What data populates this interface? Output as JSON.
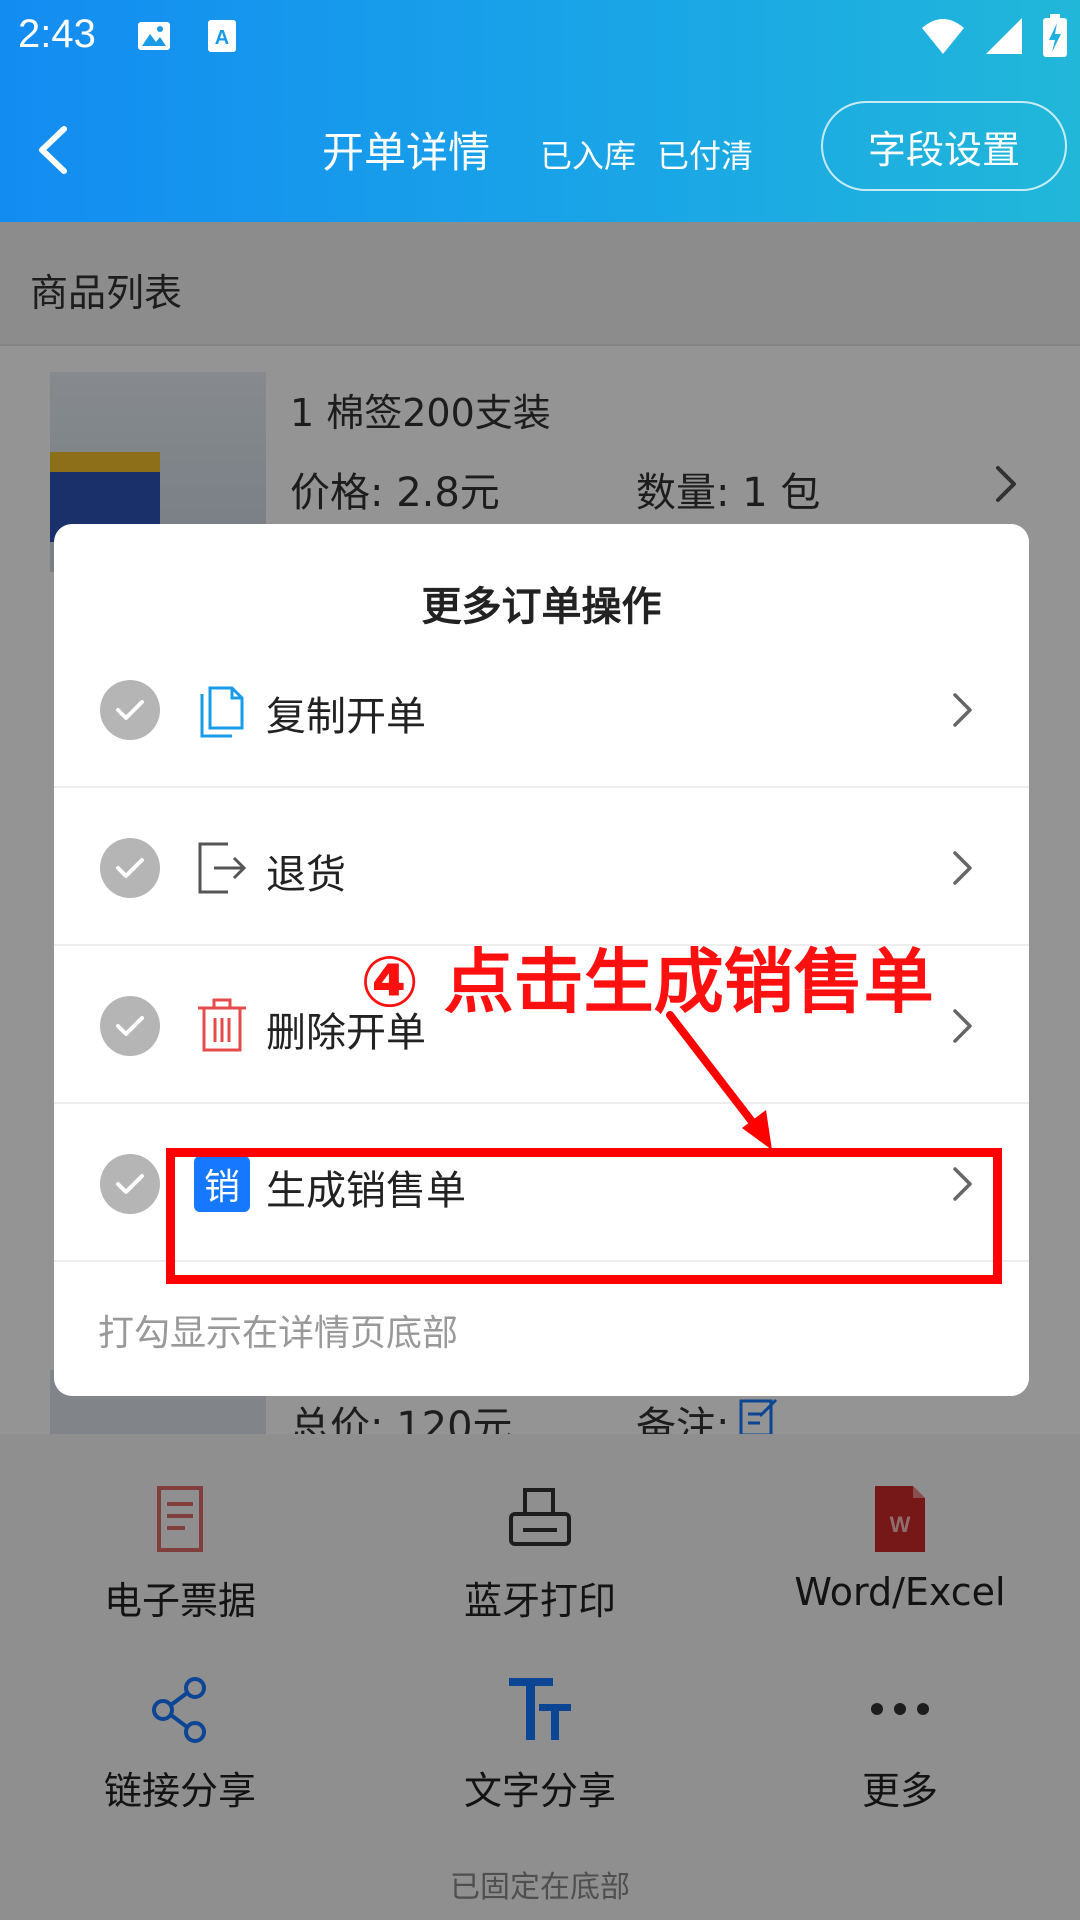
{
  "status_bar": {
    "time": "2:43"
  },
  "header": {
    "title": "开单详情",
    "status_stock": "已入库",
    "status_paid": "已付清",
    "field_settings": "字段设置"
  },
  "product_list": {
    "title": "商品列表",
    "item": {
      "name": "1 棉签200支装",
      "price": "价格: 2.8元",
      "quantity": "数量: 1 包",
      "total": "总价: 120元",
      "note_label": "备注:"
    }
  },
  "actions": [
    {
      "label": "电子票据",
      "icon": "receipt-icon"
    },
    {
      "label": "蓝牙打印",
      "icon": "printer-icon"
    },
    {
      "label": "Word/Excel",
      "icon": "word-excel-icon"
    },
    {
      "label": "链接分享",
      "icon": "share-link-icon"
    },
    {
      "label": "文字分享",
      "icon": "text-share-icon"
    },
    {
      "label": "更多",
      "icon": "more-icon"
    }
  ],
  "pinned_note": "已固定在底部",
  "dialog": {
    "title": "更多订单操作",
    "items": [
      {
        "label": "复制开单",
        "icon": "copy-icon"
      },
      {
        "label": "退货",
        "icon": "return-icon"
      },
      {
        "label": "删除开单",
        "icon": "trash-icon"
      },
      {
        "label": "生成销售单",
        "icon": "sales-order-icon",
        "icon_text": "销"
      }
    ],
    "footer": "打勾显示在详情页底部"
  },
  "annotation": {
    "text": "④ 点击生成销售单",
    "color": "#ff0000"
  },
  "colors": {
    "header_start": "#138cf2",
    "header_end": "#21b7d9",
    "accent_blue": "#1677ff",
    "danger_red": "#e54b4b"
  }
}
